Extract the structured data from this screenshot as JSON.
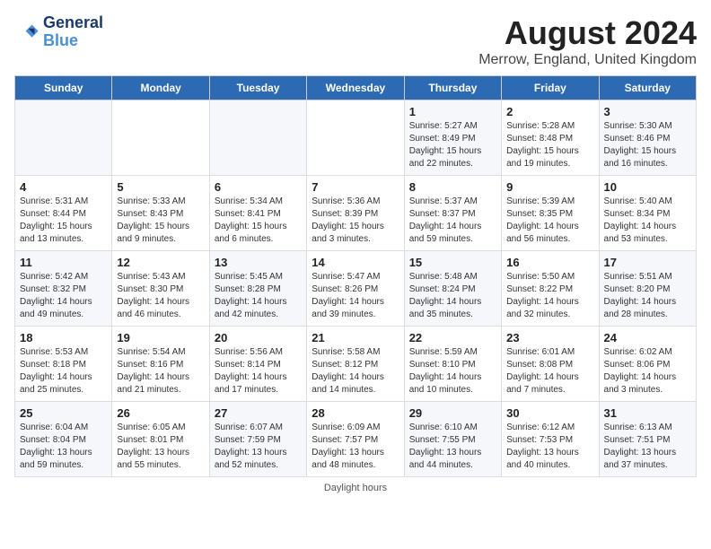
{
  "logo": {
    "line1": "General",
    "line2": "Blue"
  },
  "title": "August 2024",
  "subtitle": "Merrow, England, United Kingdom",
  "days_of_week": [
    "Sunday",
    "Monday",
    "Tuesday",
    "Wednesday",
    "Thursday",
    "Friday",
    "Saturday"
  ],
  "weeks": [
    [
      {
        "day": "",
        "info": ""
      },
      {
        "day": "",
        "info": ""
      },
      {
        "day": "",
        "info": ""
      },
      {
        "day": "",
        "info": ""
      },
      {
        "day": "1",
        "info": "Sunrise: 5:27 AM\nSunset: 8:49 PM\nDaylight: 15 hours\nand 22 minutes."
      },
      {
        "day": "2",
        "info": "Sunrise: 5:28 AM\nSunset: 8:48 PM\nDaylight: 15 hours\nand 19 minutes."
      },
      {
        "day": "3",
        "info": "Sunrise: 5:30 AM\nSunset: 8:46 PM\nDaylight: 15 hours\nand 16 minutes."
      }
    ],
    [
      {
        "day": "4",
        "info": "Sunrise: 5:31 AM\nSunset: 8:44 PM\nDaylight: 15 hours\nand 13 minutes."
      },
      {
        "day": "5",
        "info": "Sunrise: 5:33 AM\nSunset: 8:43 PM\nDaylight: 15 hours\nand 9 minutes."
      },
      {
        "day": "6",
        "info": "Sunrise: 5:34 AM\nSunset: 8:41 PM\nDaylight: 15 hours\nand 6 minutes."
      },
      {
        "day": "7",
        "info": "Sunrise: 5:36 AM\nSunset: 8:39 PM\nDaylight: 15 hours\nand 3 minutes."
      },
      {
        "day": "8",
        "info": "Sunrise: 5:37 AM\nSunset: 8:37 PM\nDaylight: 14 hours\nand 59 minutes."
      },
      {
        "day": "9",
        "info": "Sunrise: 5:39 AM\nSunset: 8:35 PM\nDaylight: 14 hours\nand 56 minutes."
      },
      {
        "day": "10",
        "info": "Sunrise: 5:40 AM\nSunset: 8:34 PM\nDaylight: 14 hours\nand 53 minutes."
      }
    ],
    [
      {
        "day": "11",
        "info": "Sunrise: 5:42 AM\nSunset: 8:32 PM\nDaylight: 14 hours\nand 49 minutes."
      },
      {
        "day": "12",
        "info": "Sunrise: 5:43 AM\nSunset: 8:30 PM\nDaylight: 14 hours\nand 46 minutes."
      },
      {
        "day": "13",
        "info": "Sunrise: 5:45 AM\nSunset: 8:28 PM\nDaylight: 14 hours\nand 42 minutes."
      },
      {
        "day": "14",
        "info": "Sunrise: 5:47 AM\nSunset: 8:26 PM\nDaylight: 14 hours\nand 39 minutes."
      },
      {
        "day": "15",
        "info": "Sunrise: 5:48 AM\nSunset: 8:24 PM\nDaylight: 14 hours\nand 35 minutes."
      },
      {
        "day": "16",
        "info": "Sunrise: 5:50 AM\nSunset: 8:22 PM\nDaylight: 14 hours\nand 32 minutes."
      },
      {
        "day": "17",
        "info": "Sunrise: 5:51 AM\nSunset: 8:20 PM\nDaylight: 14 hours\nand 28 minutes."
      }
    ],
    [
      {
        "day": "18",
        "info": "Sunrise: 5:53 AM\nSunset: 8:18 PM\nDaylight: 14 hours\nand 25 minutes."
      },
      {
        "day": "19",
        "info": "Sunrise: 5:54 AM\nSunset: 8:16 PM\nDaylight: 14 hours\nand 21 minutes."
      },
      {
        "day": "20",
        "info": "Sunrise: 5:56 AM\nSunset: 8:14 PM\nDaylight: 14 hours\nand 17 minutes."
      },
      {
        "day": "21",
        "info": "Sunrise: 5:58 AM\nSunset: 8:12 PM\nDaylight: 14 hours\nand 14 minutes."
      },
      {
        "day": "22",
        "info": "Sunrise: 5:59 AM\nSunset: 8:10 PM\nDaylight: 14 hours\nand 10 minutes."
      },
      {
        "day": "23",
        "info": "Sunrise: 6:01 AM\nSunset: 8:08 PM\nDaylight: 14 hours\nand 7 minutes."
      },
      {
        "day": "24",
        "info": "Sunrise: 6:02 AM\nSunset: 8:06 PM\nDaylight: 14 hours\nand 3 minutes."
      }
    ],
    [
      {
        "day": "25",
        "info": "Sunrise: 6:04 AM\nSunset: 8:04 PM\nDaylight: 13 hours\nand 59 minutes."
      },
      {
        "day": "26",
        "info": "Sunrise: 6:05 AM\nSunset: 8:01 PM\nDaylight: 13 hours\nand 55 minutes."
      },
      {
        "day": "27",
        "info": "Sunrise: 6:07 AM\nSunset: 7:59 PM\nDaylight: 13 hours\nand 52 minutes."
      },
      {
        "day": "28",
        "info": "Sunrise: 6:09 AM\nSunset: 7:57 PM\nDaylight: 13 hours\nand 48 minutes."
      },
      {
        "day": "29",
        "info": "Sunrise: 6:10 AM\nSunset: 7:55 PM\nDaylight: 13 hours\nand 44 minutes."
      },
      {
        "day": "30",
        "info": "Sunrise: 6:12 AM\nSunset: 7:53 PM\nDaylight: 13 hours\nand 40 minutes."
      },
      {
        "day": "31",
        "info": "Sunrise: 6:13 AM\nSunset: 7:51 PM\nDaylight: 13 hours\nand 37 minutes."
      }
    ]
  ],
  "footer": "Daylight hours"
}
